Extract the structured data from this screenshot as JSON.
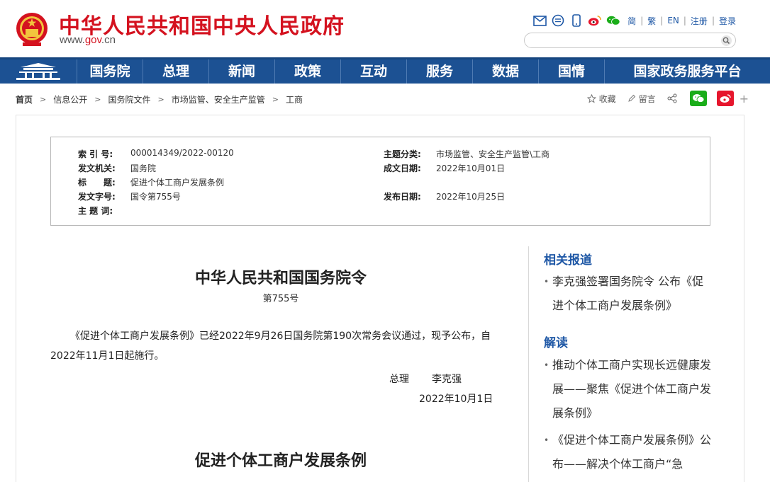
{
  "header": {
    "site_title": "中华人民共和国中央人民政府",
    "domain_prefix": "www.",
    "domain_brand": "gov",
    "domain_suffix": ".cn",
    "links": [
      "简",
      "繁",
      "EN",
      "注册",
      "登录"
    ],
    "search_placeholder": ""
  },
  "nav": {
    "items": [
      "国务院",
      "总理",
      "新闻",
      "政策",
      "互动",
      "服务",
      "数据",
      "国情",
      "国家政务服务平台"
    ]
  },
  "breadcrumb": [
    "首页",
    "信息公开",
    "国务院文件",
    "市场监管、安全生产监管",
    "工商"
  ],
  "share": {
    "favorite": "收藏",
    "comment": "留言",
    "plus": "+"
  },
  "meta": {
    "index_label": "索 引 号:",
    "index_value": "000014349/2022-00120",
    "subject_label": "主题分类:",
    "subject_value": "市场监管、安全生产监管\\工商",
    "issuer_label": "发文机关:",
    "issuer_value": "国务院",
    "created_label": "成文日期:",
    "created_value": "2022年10月01日",
    "title_label": "标　　题:",
    "title_value": "促进个体工商户发展条例",
    "docno_label": "发文字号:",
    "docno_value": "国令第755号",
    "published_label": "发布日期:",
    "published_value": "2022年10月25日",
    "keywords_label": "主 题 词:",
    "keywords_value": ""
  },
  "article": {
    "title": "中华人民共和国国务院令",
    "number": "第755号",
    "paragraph": "《促进个体工商户发展条例》已经2022年9月26日国务院第190次常务会议通过，现予公布，自2022年11月1日起施行。",
    "sign_role": "总理",
    "sign_name": "李克强",
    "date": "2022年10月1日",
    "subtitle": "促进个体工商户发展条例"
  },
  "sidebar": {
    "related_heading": "相关报道",
    "related_items": [
      "李克强签署国务院令 公布《促进个体工商户发展条例》"
    ],
    "interpret_heading": "解读",
    "interpret_items": [
      "推动个体工商户实现长远健康发展——聚焦《促进个体工商户发展条例》",
      "《促进个体工商户发展条例》公布——解决个体工商户“急"
    ]
  },
  "colors": {
    "brand_red": "#d4121f",
    "nav_blue": "#1c5193",
    "link_blue": "#1f58a6"
  }
}
